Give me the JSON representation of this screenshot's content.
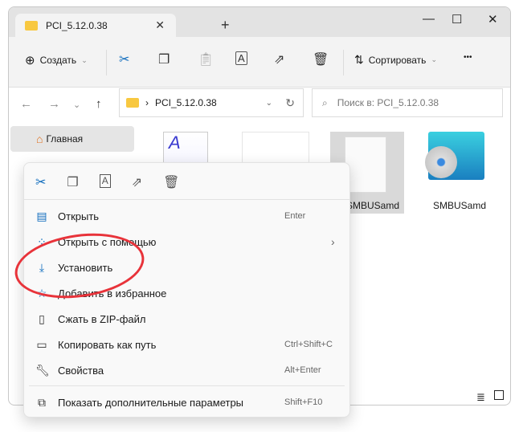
{
  "window": {
    "tab_title": "PCI_5.12.0.38",
    "new_tab": "+",
    "minimize": "—",
    "maximize": "☐",
    "close": "✕"
  },
  "toolbar": {
    "create": "Создать",
    "sort": "Сортировать",
    "more": "•••"
  },
  "address": {
    "path": "PCI_5.12.0.38",
    "search_placeholder": "Поиск в: PCI_5.12.0.38"
  },
  "sidebar": {
    "home": "Главная"
  },
  "files": [
    {
      "name": "SMBUSamd"
    },
    {
      "name": "SMBUSamd"
    }
  ],
  "context_menu": {
    "items": [
      {
        "label": "Открыть",
        "shortcut": "Enter",
        "icon": "notepad-icon"
      },
      {
        "label": "Открыть с помощью",
        "shortcut": "›",
        "icon": "open-with-icon"
      },
      {
        "label": "Установить",
        "shortcut": "",
        "icon": "install-icon"
      },
      {
        "label": "Добавить в избранное",
        "shortcut": "",
        "icon": "star-icon"
      },
      {
        "label": "Сжать в ZIP-файл",
        "shortcut": "",
        "icon": "zip-icon"
      },
      {
        "label": "Копировать как путь",
        "shortcut": "Ctrl+Shift+C",
        "icon": "path-icon"
      },
      {
        "label": "Свойства",
        "shortcut": "Alt+Enter",
        "icon": "wrench-icon"
      }
    ],
    "more": {
      "label": "Показать дополнительные параметры",
      "shortcut": "Shift+F10"
    }
  },
  "colors": {
    "highlight": "#e8333a",
    "accent": "#0f6cbd"
  }
}
